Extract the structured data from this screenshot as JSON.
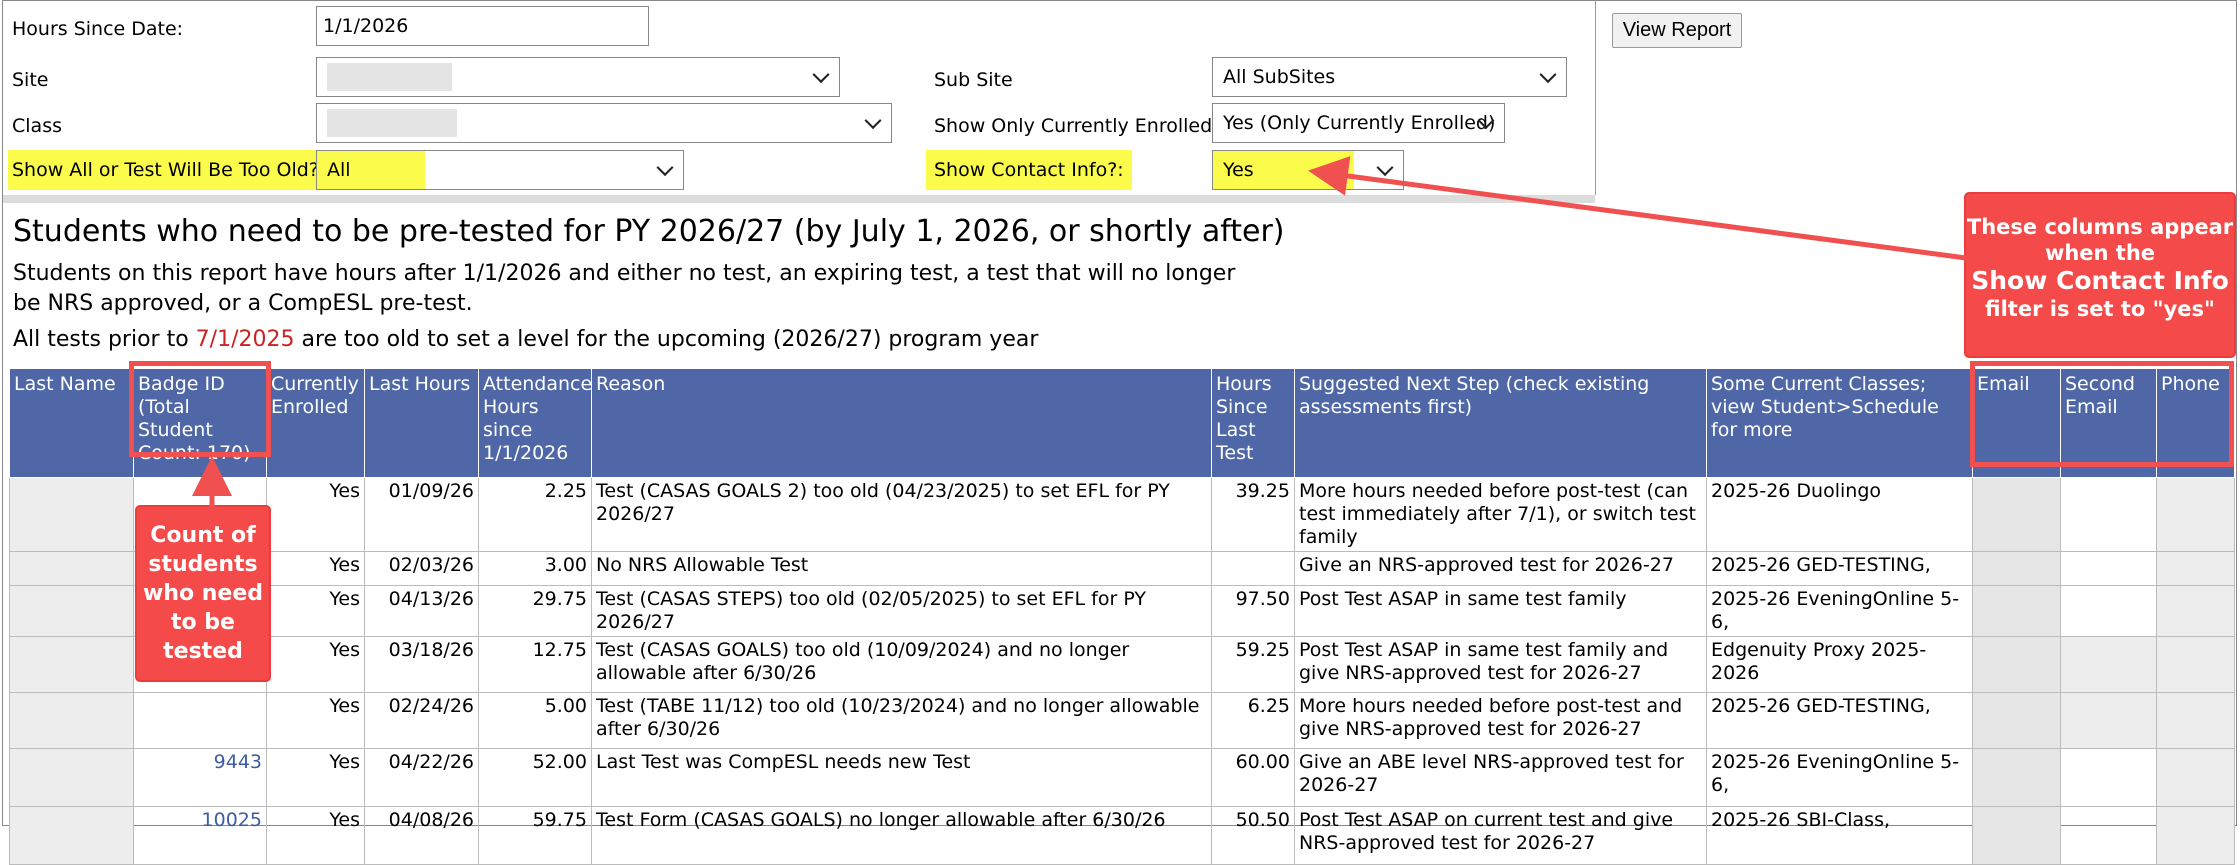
{
  "filters": {
    "hours_since_label": "Hours Since Date:",
    "hours_since_value": "1/1/2026",
    "site_label": "Site",
    "class_label": "Class",
    "show_all_label": "Show All or Test Will Be Too Old?:",
    "show_all_value": "All",
    "subsite_label": "Sub Site",
    "subsite_value": "All SubSites",
    "enrolled_label": "Show Only Currently Enrolled?",
    "enrolled_value": "Yes (Only Currently Enrolled)",
    "contact_label": "Show Contact Info?:",
    "contact_value": "Yes",
    "view_report": "View Report"
  },
  "report": {
    "title": "Students who need to be pre-tested for PY 2026/27 (by July 1, 2026, or shortly after)",
    "description": "Students on this report have hours after 1/1/2026 and either no test, an expiring test, a test that will no longer be NRS approved, or a  CompESL pre-test.",
    "note_prefix": "All tests prior to ",
    "note_date": "7/1/2025",
    "note_suffix": " are too old to set a level for the upcoming (2026/27) program year"
  },
  "table": {
    "headers": {
      "last_name": "Last Name",
      "badge_id": "Badge ID (Total Student Count: 170)",
      "currently_enrolled": "Currently Enrolled",
      "last_hours": "Last Hours",
      "attendance": "Attendance Hours since 1/1/2026",
      "reason": "Reason",
      "hours_since_test": "Hours Since Last Test",
      "next_step": "Suggested Next Step (check existing assessments first)",
      "classes": "Some Current Classes; view Student>Schedule for more",
      "email": "Email",
      "second_email": "Second Email",
      "phone": "Phone"
    },
    "rows": [
      {
        "badge": "",
        "enrolled": "Yes",
        "last_hours": "01/09/26",
        "attendance": "2.25",
        "reason": "Test (CASAS GOALS 2) too old (04/23/2025) to set EFL for PY 2026/27",
        "hours_since": "39.25",
        "next_step": "More hours needed before post-test (can test immediately after 7/1), or switch test family",
        "classes": "2025-26 Duolingo"
      },
      {
        "badge": "",
        "enrolled": "Yes",
        "last_hours": "02/03/26",
        "attendance": "3.00",
        "reason": "No NRS Allowable Test",
        "hours_since": "",
        "next_step": "Give an NRS-approved test for 2026-27",
        "classes": "2025-26 GED-TESTING,"
      },
      {
        "badge": "",
        "enrolled": "Yes",
        "last_hours": "04/13/26",
        "attendance": "29.75",
        "reason": "Test (CASAS STEPS) too old (02/05/2025) to set EFL for PY 2026/27",
        "hours_since": "97.50",
        "next_step": "Post Test ASAP in same test family",
        "classes": "2025-26 EveningOnline 5-6,"
      },
      {
        "badge": "",
        "enrolled": "Yes",
        "last_hours": "03/18/26",
        "attendance": "12.75",
        "reason": "Test (CASAS GOALS) too old (10/09/2024) and no longer allowable after 6/30/26",
        "hours_since": "59.25",
        "next_step": "Post Test ASAP in same test family and give NRS-approved test for 2026-27",
        "classes": "Edgenuity Proxy 2025-2026"
      },
      {
        "badge": "",
        "enrolled": "Yes",
        "last_hours": "02/24/26",
        "attendance": "5.00",
        "reason": "Test (TABE 11/12) too old (10/23/2024) and no longer allowable after 6/30/26",
        "hours_since": "6.25",
        "next_step": "More hours needed before post-test and give NRS-approved test for 2026-27",
        "classes": "2025-26 GED-TESTING,"
      },
      {
        "badge": "9443",
        "enrolled": "Yes",
        "last_hours": "04/22/26",
        "attendance": "52.00",
        "reason": "Last Test was CompESL needs new Test",
        "hours_since": "60.00",
        "next_step": "Give an ABE level NRS-approved test for 2026-27",
        "classes": "2025-26 EveningOnline 5-6,"
      },
      {
        "badge": "10025",
        "enrolled": "Yes",
        "last_hours": "04/08/26",
        "attendance": "59.75",
        "reason": "Test Form (CASAS GOALS) no longer allowable after 6/30/26",
        "hours_since": "50.50",
        "next_step": "Post Test ASAP on current test and give NRS-approved test for 2026-27",
        "classes": "2025-26 SBI-Class,"
      }
    ]
  },
  "annotations": {
    "contact_callout_line1": "These columns appear when the",
    "contact_callout_line2": "Show Contact Info",
    "contact_callout_line3": "filter is set to \"yes\"",
    "count_callout": "Count of students who need to be tested"
  },
  "colors": {
    "header_bg": "#4f67a6",
    "highlight": "#fbfb4c",
    "callout": "#f44a4a",
    "note_date": "#cc2222"
  }
}
